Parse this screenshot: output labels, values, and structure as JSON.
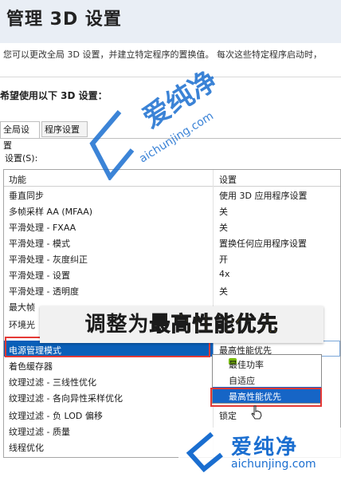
{
  "header": {
    "title": "管理 3D 设置",
    "description": "您可以更改全局 3D 设置，并建立特定程序的置换值。 每次这些特定程序启动时，"
  },
  "prompt": "希望使用以下 3D 设置：",
  "tabs": [
    {
      "label": "全局设置",
      "active": true
    },
    {
      "label": "程序设置",
      "active": false
    }
  ],
  "settings_label": "设置(S):",
  "columns": {
    "feature": "功能",
    "setting": "设置"
  },
  "rows": [
    {
      "feature": "垂直同步",
      "value": "使用 3D 应用程序设置"
    },
    {
      "feature": "多帧采样 AA (MFAA)",
      "value": "关"
    },
    {
      "feature": "平滑处理 - FXAA",
      "value": "关"
    },
    {
      "feature": "平滑处理 - 模式",
      "value": "置换任何应用程序设置"
    },
    {
      "feature": "平滑处理 - 灰度纠正",
      "value": "开"
    },
    {
      "feature": "平滑处理 - 设置",
      "value": "4x"
    },
    {
      "feature": "平滑处理 - 透明度",
      "value": "关"
    },
    {
      "feature": "最大帧",
      "value": ""
    },
    {
      "feature": "环境光",
      "value": ""
    },
    {
      "feature": "电源管理模式",
      "value": "最高性能优先",
      "selected": true
    },
    {
      "feature": "着色缓存器",
      "value": ""
    },
    {
      "feature": "纹理过滤 - 三线性优化",
      "value": ""
    },
    {
      "feature": "纹理过滤 - 各向异性采样优化",
      "value": ""
    },
    {
      "feature": "纹理过滤 - 负 LOD 偏移",
      "value": "锁定"
    },
    {
      "feature": "纹理过滤 - 质量",
      "value": ""
    },
    {
      "feature": "线程优化",
      "value": ""
    }
  ],
  "dropdown": {
    "options": [
      {
        "label": "最佳功率",
        "checked": true
      },
      {
        "label": "自适应"
      },
      {
        "label": "最高性能优先",
        "highlighted": true
      }
    ]
  },
  "banner": {
    "prefix": "调整为",
    "highlight": "最高性能优先"
  },
  "watermark": {
    "brand": "爱纯净",
    "url": "aichunjing.com"
  },
  "colors": {
    "selection": "#0a5fb8",
    "highlight_frame": "#e53935",
    "banner_text": "#e8c21a",
    "watermark": "#1a6ed0"
  }
}
